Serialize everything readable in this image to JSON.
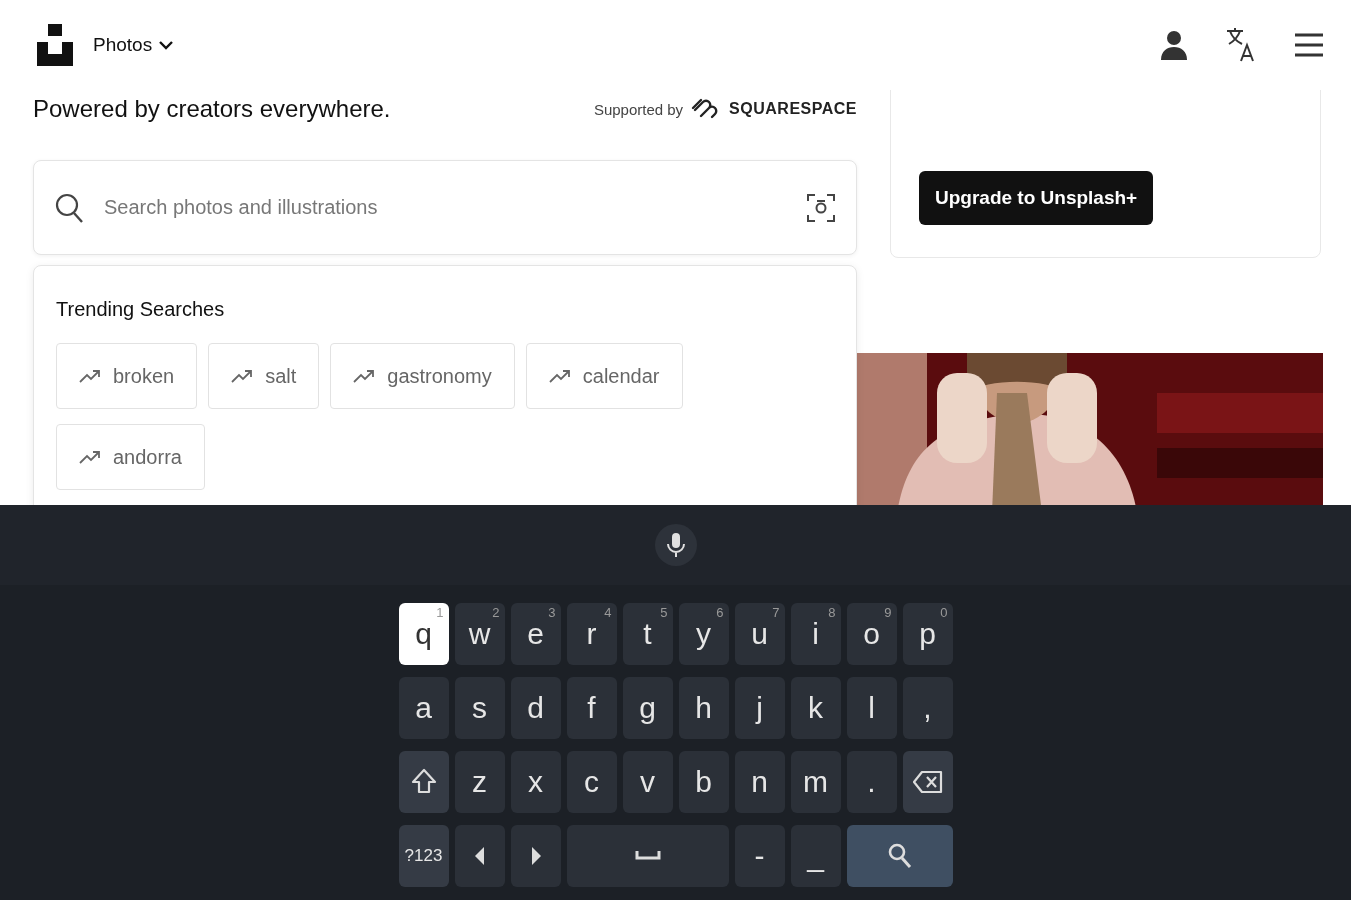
{
  "header": {
    "nav_menu": {
      "label": "Photos"
    }
  },
  "tagline": "Powered by creators everywhere.",
  "supported_by": {
    "label": "Supported by",
    "brand": "SQUARESPACE"
  },
  "search": {
    "placeholder": "Search photos and illustrations"
  },
  "trending": {
    "title": "Trending Searches",
    "items": [
      {
        "label": "broken"
      },
      {
        "label": "salt"
      },
      {
        "label": "gastronomy"
      },
      {
        "label": "calendar"
      },
      {
        "label": "andorra"
      }
    ]
  },
  "promo": {
    "button": "Upgrade to Unsplash+"
  },
  "keyboard": {
    "rows": [
      {
        "keys": [
          {
            "kind": "char",
            "label": "q",
            "hint": "1",
            "pressed": true
          },
          {
            "kind": "char",
            "label": "w",
            "hint": "2",
            "pressed": false
          },
          {
            "kind": "char",
            "label": "e",
            "hint": "3",
            "pressed": false
          },
          {
            "kind": "char",
            "label": "r",
            "hint": "4",
            "pressed": false
          },
          {
            "kind": "char",
            "label": "t",
            "hint": "5",
            "pressed": false
          },
          {
            "kind": "char",
            "label": "y",
            "hint": "6",
            "pressed": false
          },
          {
            "kind": "char",
            "label": "u",
            "hint": "7",
            "pressed": false
          },
          {
            "kind": "char",
            "label": "i",
            "hint": "8",
            "pressed": false
          },
          {
            "kind": "char",
            "label": "o",
            "hint": "9",
            "pressed": false
          },
          {
            "kind": "char",
            "label": "p",
            "hint": "0",
            "pressed": false
          }
        ]
      },
      {
        "keys": [
          {
            "kind": "char",
            "label": "a",
            "pressed": false
          },
          {
            "kind": "char",
            "label": "s",
            "pressed": false
          },
          {
            "kind": "char",
            "label": "d",
            "pressed": false
          },
          {
            "kind": "char",
            "label": "f",
            "pressed": false
          },
          {
            "kind": "char",
            "label": "g",
            "pressed": false
          },
          {
            "kind": "char",
            "label": "h",
            "pressed": false
          },
          {
            "kind": "char",
            "label": "j",
            "pressed": false
          },
          {
            "kind": "char",
            "label": "k",
            "pressed": false
          },
          {
            "kind": "char",
            "label": "l",
            "pressed": false
          },
          {
            "kind": "char",
            "label": ",",
            "pressed": false
          }
        ]
      },
      {
        "keys": [
          {
            "kind": "shift",
            "pressed": false
          },
          {
            "kind": "char",
            "label": "z",
            "pressed": false
          },
          {
            "kind": "char",
            "label": "x",
            "pressed": false
          },
          {
            "kind": "char",
            "label": "c",
            "pressed": false
          },
          {
            "kind": "char",
            "label": "v",
            "pressed": false
          },
          {
            "kind": "char",
            "label": "b",
            "pressed": false
          },
          {
            "kind": "char",
            "label": "n",
            "pressed": false
          },
          {
            "kind": "char",
            "label": "m",
            "pressed": false
          },
          {
            "kind": "char",
            "label": ".",
            "pressed": false
          },
          {
            "kind": "backspace",
            "pressed": false
          }
        ]
      },
      {
        "keys": [
          {
            "kind": "symbols",
            "label": "?123",
            "pressed": false
          },
          {
            "kind": "left",
            "pressed": false
          },
          {
            "kind": "right",
            "pressed": false
          },
          {
            "kind": "space",
            "pressed": false
          },
          {
            "kind": "char",
            "label": "-",
            "pressed": false
          },
          {
            "kind": "char",
            "label": "_",
            "pressed": false
          },
          {
            "kind": "search",
            "pressed": false
          }
        ]
      }
    ]
  }
}
